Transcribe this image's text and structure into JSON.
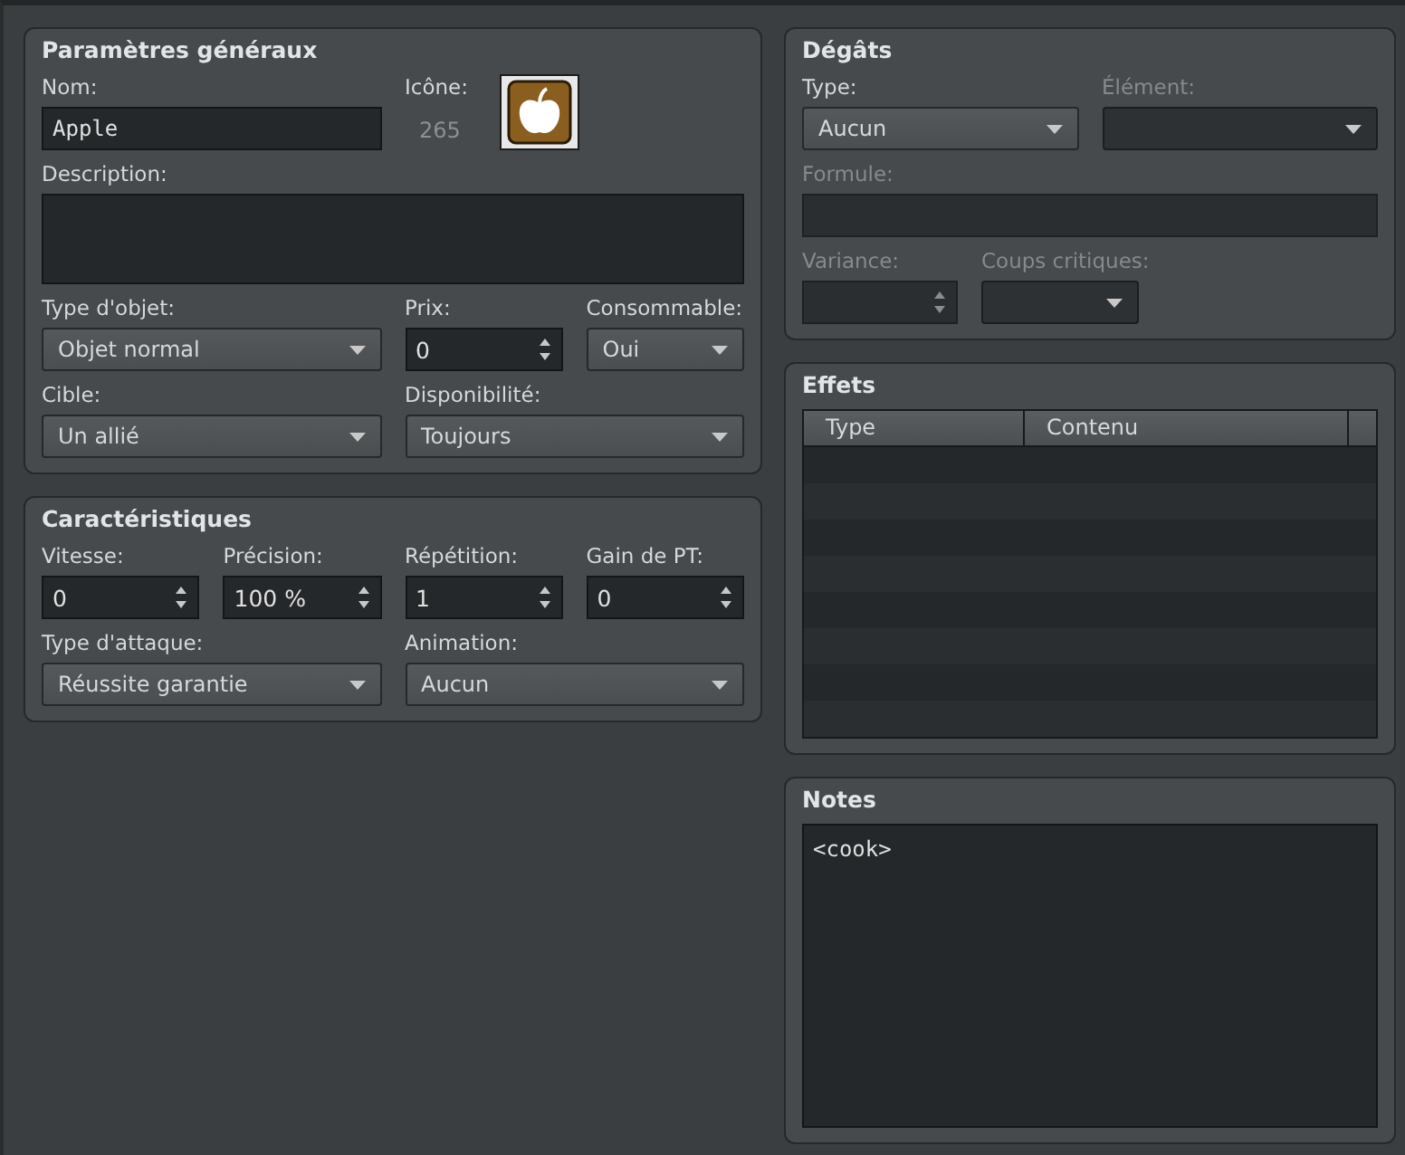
{
  "left": [
    {
      "title": "Paramètres généraux",
      "kind": "form",
      "fields": [
        {
          "kind": "text",
          "label": "Nom:",
          "value": "Apple",
          "disabled": false
        },
        {
          "kind": "icon",
          "label": "Icône:",
          "value": "265",
          "disabled": false
        },
        {
          "kind": "textarea",
          "label": "Description:",
          "disabled": false
        },
        {
          "kind": "combo",
          "label": "Type d'objet:",
          "value": "Objet normal",
          "disabled": false
        },
        {
          "kind": "spin",
          "label": "Prix:",
          "value": "0",
          "disabled": false
        },
        {
          "kind": "combo",
          "label": "Consommable:",
          "value": "Oui",
          "disabled": false
        },
        {
          "kind": "combo",
          "label": "Cible:",
          "value": "Un allié",
          "disabled": false
        },
        {
          "kind": "combo",
          "label": "Disponibilité:",
          "value": "Toujours",
          "disabled": false
        }
      ]
    },
    {
      "title": "Caractéristiques",
      "kind": "form",
      "fields": [
        {
          "kind": "spin",
          "label": "Vitesse:",
          "value": "0",
          "disabled": false
        },
        {
          "kind": "spin",
          "label": "Précision:",
          "value": "100 %",
          "disabled": false
        },
        {
          "kind": "spin",
          "label": "Répétition:",
          "value": "1",
          "disabled": false
        },
        {
          "kind": "spin",
          "label": "Gain de PT:",
          "value": "0",
          "disabled": false
        },
        {
          "kind": "combo",
          "label": "Type d'attaque:",
          "value": "Réussite garantie",
          "disabled": false
        },
        {
          "kind": "combo",
          "label": "Animation:",
          "value": "Aucun",
          "disabled": false
        }
      ]
    }
  ],
  "right": [
    {
      "title": "Dégâts",
      "kind": "form",
      "fields": [
        {
          "kind": "combo",
          "label": "Type:",
          "value": "Aucun",
          "disabled": false
        },
        {
          "kind": "combo",
          "label": "Élément:",
          "disabled": true
        },
        {
          "kind": "text",
          "label": "Formule:",
          "disabled": true
        },
        {
          "kind": "spin",
          "label": "Variance:",
          "disabled": true
        },
        {
          "kind": "combo",
          "label": "Coups critiques:",
          "disabled": true
        }
      ]
    },
    {
      "title": "Effets",
      "kind": "table",
      "columns": [
        "Type",
        "Contenu"
      ]
    },
    {
      "title": "Notes",
      "kind": "notes",
      "value": "<cook>"
    }
  ]
}
